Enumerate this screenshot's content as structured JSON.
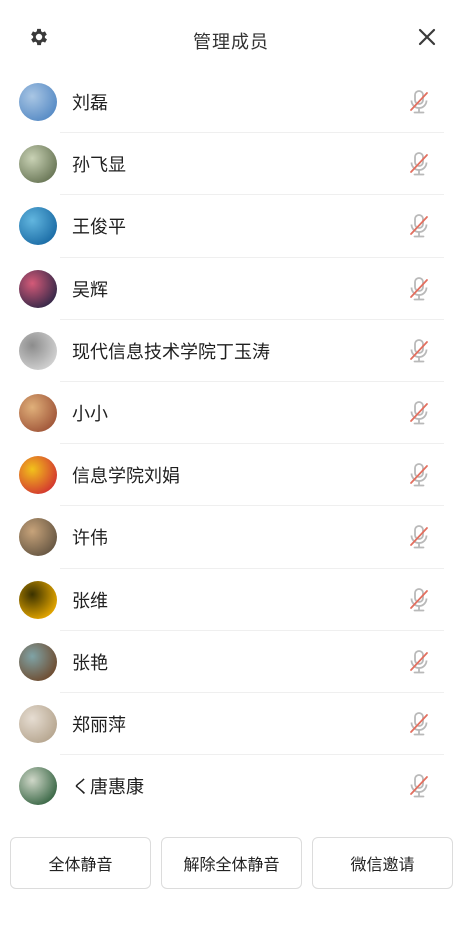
{
  "header": {
    "title": "管理成员",
    "settings_icon": "gear-icon",
    "close_icon": "close-icon"
  },
  "members": [
    {
      "name": "刘磊",
      "avatar_colors": [
        "#5a8dc6",
        "#a9c6e4"
      ]
    },
    {
      "name": "孙飞显",
      "avatar_colors": [
        "#6d7a5a",
        "#c9d2b5"
      ]
    },
    {
      "name": "王俊平",
      "avatar_colors": [
        "#1e6fa8",
        "#62b6df"
      ]
    },
    {
      "name": "吴辉",
      "avatar_colors": [
        "#3b2a4a",
        "#d45a78"
      ]
    },
    {
      "name": "现代信息技术学院丁玉涛",
      "avatar_colors": [
        "#cfcfcf",
        "#8c8c8c"
      ]
    },
    {
      "name": "小小",
      "avatar_colors": [
        "#a35a3c",
        "#e0b07a"
      ]
    },
    {
      "name": "信息学院刘娟",
      "avatar_colors": [
        "#d43b2f",
        "#f2c21b"
      ]
    },
    {
      "name": "许伟",
      "avatar_colors": [
        "#6b5a45",
        "#c7a37a"
      ]
    },
    {
      "name": "张维",
      "avatar_colors": [
        "#e0a300",
        "#3b3200"
      ]
    },
    {
      "name": "张艳",
      "avatar_colors": [
        "#6f4f34",
        "#7fa3a6"
      ]
    },
    {
      "name": "郑丽萍",
      "avatar_colors": [
        "#b8a892",
        "#e6ddd2"
      ]
    },
    {
      "name": "く唐惠康",
      "avatar_colors": [
        "#3f6b4a",
        "#cfd7c8"
      ]
    }
  ],
  "mic_icon": "mic-muted-icon",
  "mic_muted_color": "#e36f5f",
  "mic_color": "#b9b9b9",
  "actions": {
    "mute_all": "全体静音",
    "unmute_all": "解除全体静音",
    "wechat_invite": "微信邀请"
  }
}
